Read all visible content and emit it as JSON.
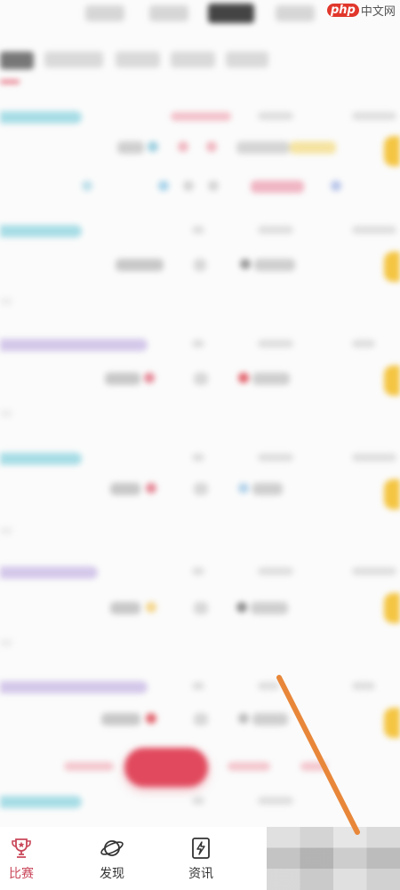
{
  "watermark": {
    "logo": "php",
    "text": "中文网"
  },
  "bottom_nav": {
    "items": [
      {
        "label": "比赛",
        "icon": "trophy-icon",
        "active": true
      },
      {
        "label": "发现",
        "icon": "planet-icon",
        "active": false
      },
      {
        "label": "资讯",
        "icon": "news-lightning-icon",
        "active": false
      }
    ]
  },
  "colors": {
    "accent": "#e14a5e",
    "nav_active": "#c9475a",
    "highlight": "#f4c542",
    "arrow": "#e8873a"
  }
}
